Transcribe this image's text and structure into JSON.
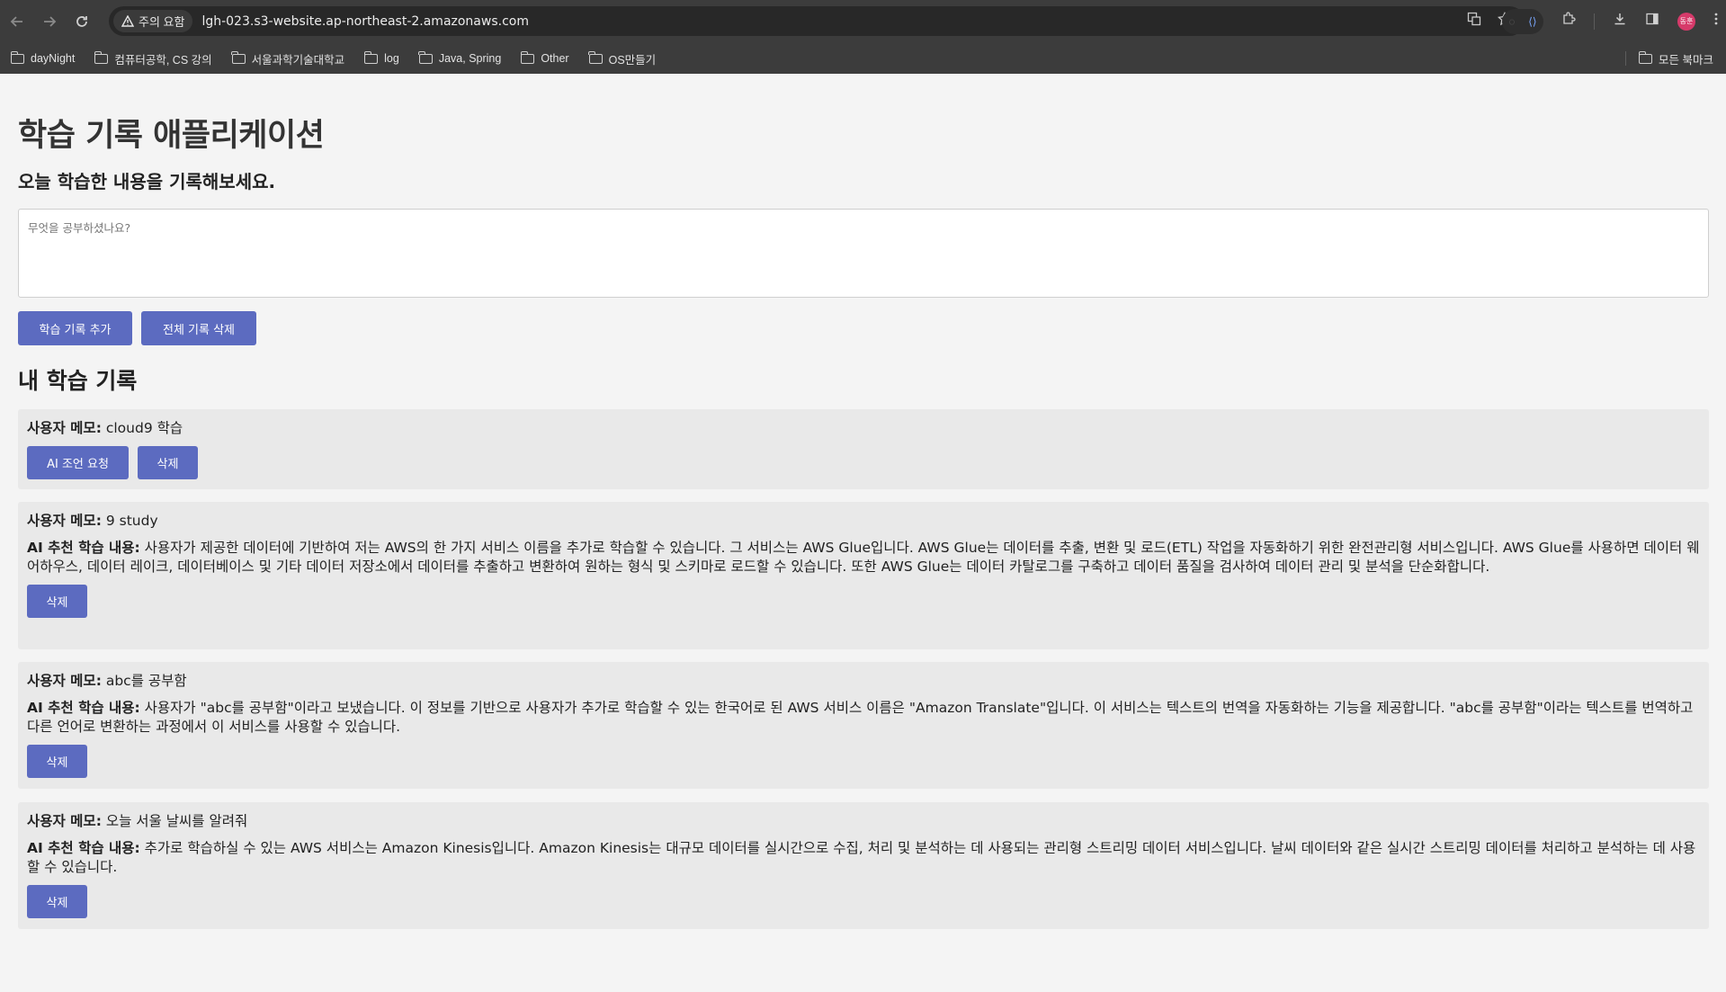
{
  "browser": {
    "security_label": "주의 요함",
    "url": "lgh-023.s3-website.ap-northeast-2.amazonaws.com",
    "avatar_text": "동훈",
    "bookmarks": [
      "dayNight",
      "컴퓨터공학, CS 강의",
      "서울과학기술대학교",
      "log",
      "Java, Spring",
      "Other",
      "OS만들기"
    ],
    "all_bookmarks": "모든 북마크"
  },
  "app": {
    "title": "학습 기록 애플리케이션",
    "prompt": "오늘 학습한 내용을 기록해보세요.",
    "input_placeholder": "무엇을 공부하셨나요?",
    "add_button": "학습 기록 추가",
    "clear_button": "전체 기록 삭제",
    "records_title": "내 학습 기록",
    "memo_label": "사용자 메모:",
    "ai_label": "AI 추천 학습 내용:",
    "ai_request_button": "AI 조언 요청",
    "delete_button": "삭제"
  },
  "records": [
    {
      "memo": "cloud9 학습",
      "ai": ""
    },
    {
      "memo": "9 study",
      "ai": "사용자가 제공한 데이터에 기반하여 저는 AWS의 한 가지 서비스 이름을 추가로 학습할 수 있습니다. 그 서비스는 AWS Glue입니다. AWS Glue는 데이터를 추출, 변환 및 로드(ETL) 작업을 자동화하기 위한 완전관리형 서비스입니다. AWS Glue를 사용하면 데이터 웨어하우스, 데이터 레이크, 데이터베이스 및 기타 데이터 저장소에서 데이터를 추출하고 변환하여 원하는 형식 및 스키마로 로드할 수 있습니다. 또한 AWS Glue는 데이터 카탈로그를 구축하고 데이터 품질을 검사하여 데이터 관리 및 분석을 단순화합니다."
    },
    {
      "memo": "abc를 공부함",
      "ai": "사용자가 \"abc를 공부함\"이라고 보냈습니다. 이 정보를 기반으로 사용자가 추가로 학습할 수 있는 한국어로 된 AWS 서비스 이름은 \"Amazon Translate\"입니다. 이 서비스는 텍스트의 번역을 자동화하는 기능을 제공합니다. \"abc를 공부함\"이라는 텍스트를 번역하고 다른 언어로 변환하는 과정에서 이 서비스를 사용할 수 있습니다."
    },
    {
      "memo": "오늘 서울 날씨를 알려줘",
      "ai": "추가로 학습하실 수 있는 AWS 서비스는 Amazon Kinesis입니다. Amazon Kinesis는 대규모 데이터를 실시간으로 수집, 처리 및 분석하는 데 사용되는 관리형 스트리밍 데이터 서비스입니다. 날씨 데이터와 같은 실시간 스트리밍 데이터를 처리하고 분석하는 데 사용할 수 있습니다."
    }
  ],
  "colors": {
    "button": "#5c6bc0",
    "chrome": "#3c3c3c",
    "page_bg": "#f4f4f4",
    "card_bg": "#e9e9e9"
  }
}
